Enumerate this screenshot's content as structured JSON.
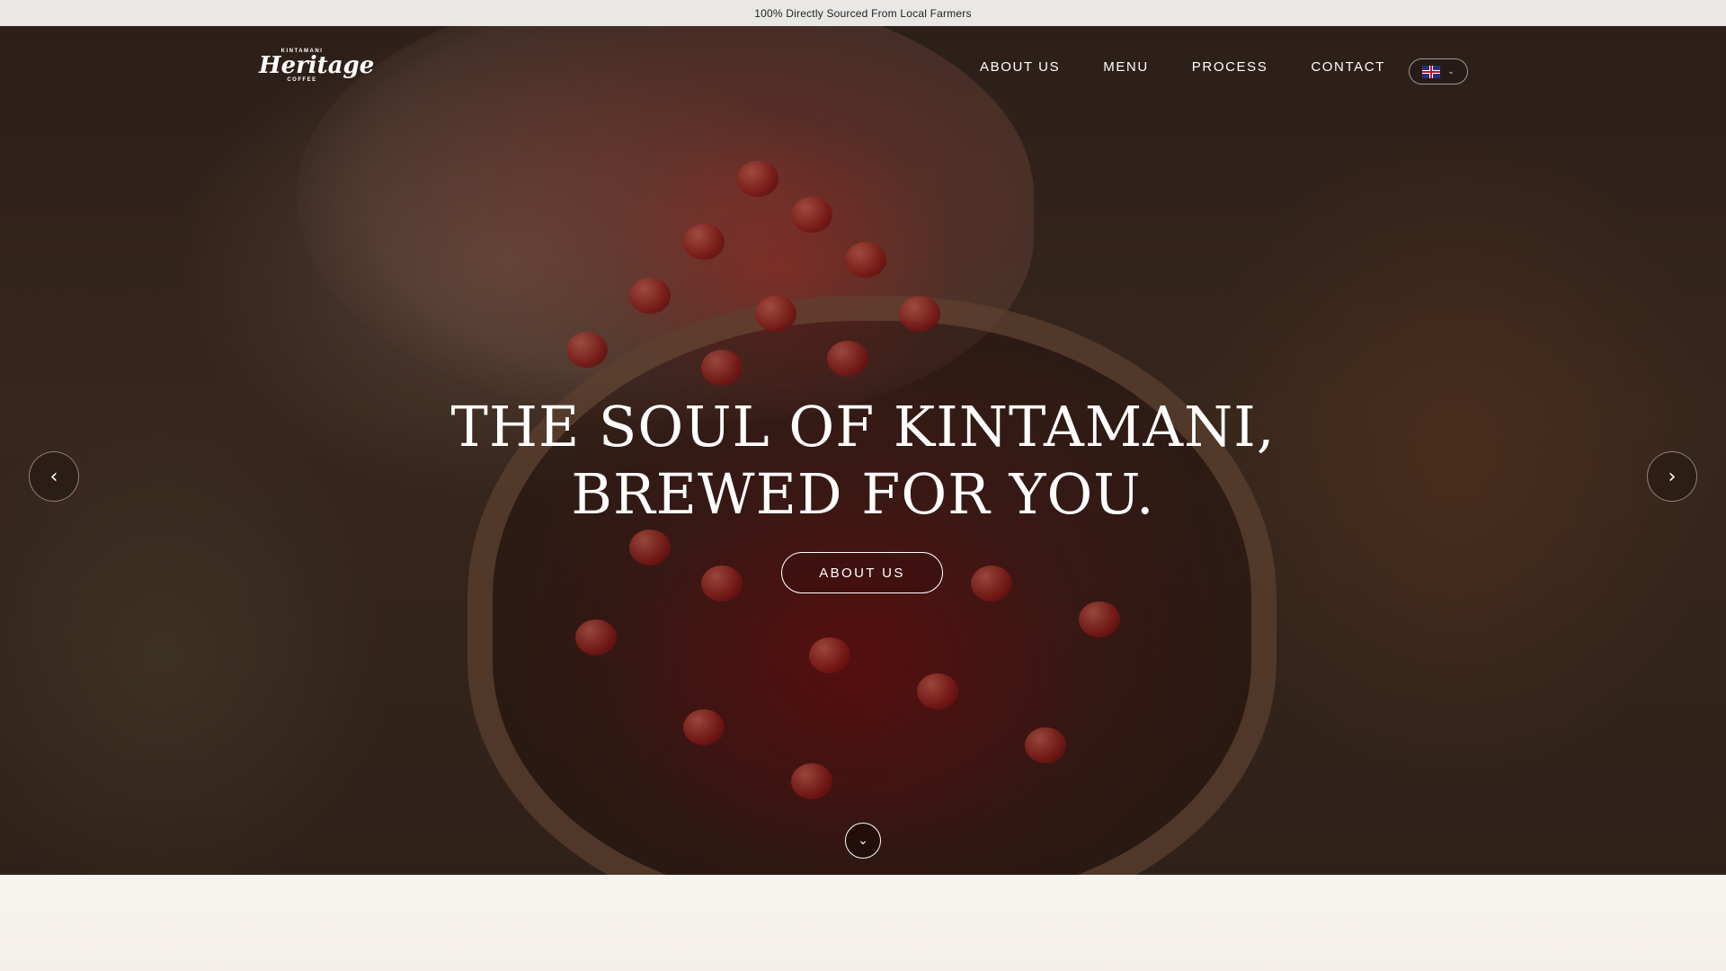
{
  "announcement": {
    "text": "100% Directly Sourced From Local Farmers"
  },
  "logo": {
    "top": "KINTAMANI",
    "script": "Heritage",
    "bottom": "COFFEE"
  },
  "nav": {
    "items": [
      {
        "label": "ABOUT US"
      },
      {
        "label": "MENU"
      },
      {
        "label": "PROCESS"
      },
      {
        "label": "CONTACT"
      }
    ],
    "language": {
      "flag": "uk-flag-icon",
      "chevron": "chevron-down-icon"
    }
  },
  "hero": {
    "headline_line1": "THE SOUL OF KINTAMANI,",
    "headline_line2": "BREWED FOR YOU.",
    "cta_label": "ABOUT US",
    "prev_icon": "chevron-left-icon",
    "next_icon": "chevron-right-icon",
    "scroll_icon": "chevron-down-icon"
  },
  "colors": {
    "announcement_bg": "#e9e8e6",
    "section_bg": "#f6f1ec",
    "text_light": "#ffffff"
  }
}
